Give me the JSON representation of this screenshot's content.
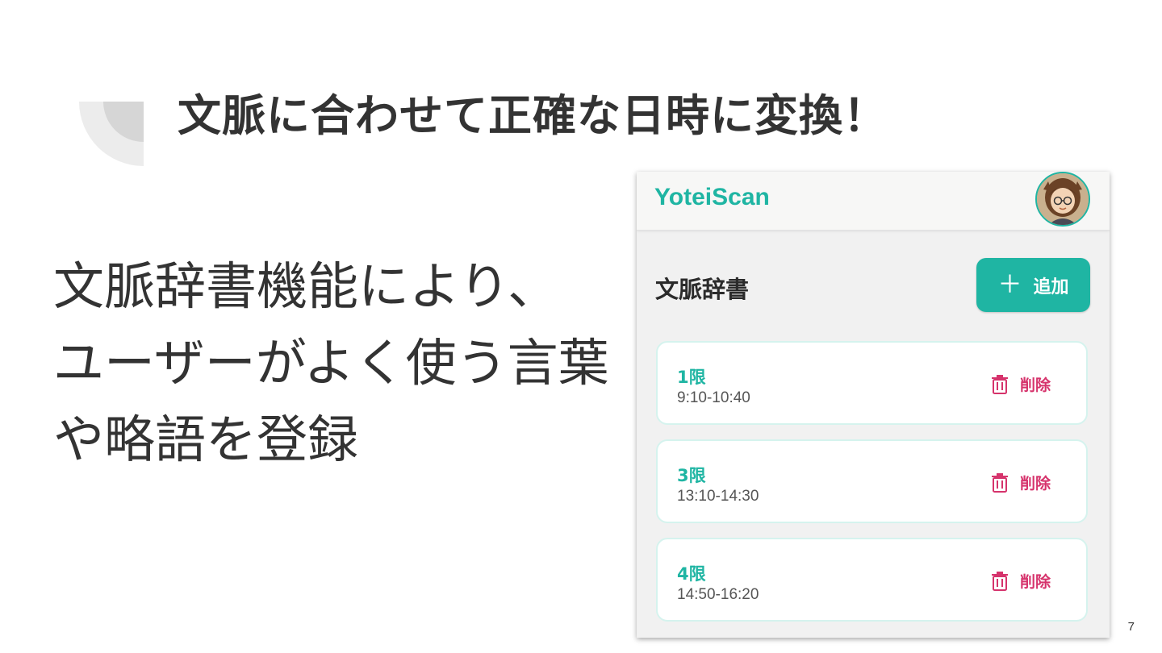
{
  "slide": {
    "title": "文脈に合わせて正確な日時に変換！",
    "body_lines": [
      "文脈辞書機能により、",
      "ユーザーがよく使う言葉",
      "や略語を登録"
    ],
    "page_number": "7"
  },
  "app": {
    "name": "YoteiScan",
    "avatar_icon": "user-avatar-icon",
    "section_title": "文脈辞書",
    "add_button": {
      "icon": "plus-icon",
      "label": "追加"
    },
    "entries": [
      {
        "label": "1限",
        "time": "9:10-10:40",
        "delete_label": "削除",
        "delete_icon": "trash-icon"
      },
      {
        "label": "3限",
        "time": "13:10-14:30",
        "delete_label": "削除",
        "delete_icon": "trash-icon"
      },
      {
        "label": "4限",
        "time": "14:50-16:20",
        "delete_label": "削除",
        "delete_icon": "trash-icon"
      }
    ]
  },
  "colors": {
    "accent": "#1fb5a3",
    "delete": "#d6336c",
    "text": "#333333",
    "app_background": "#f1f1f1",
    "card_border": "#d5f3ee"
  }
}
